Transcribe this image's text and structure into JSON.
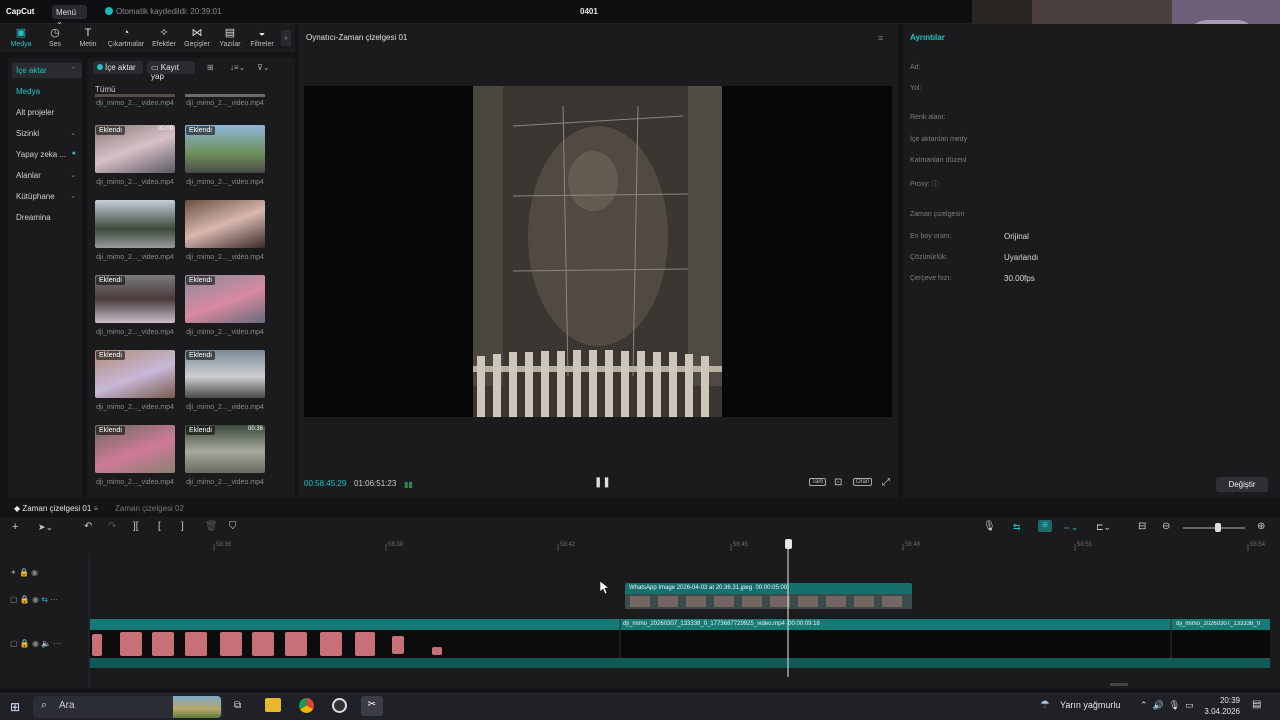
{
  "app": {
    "logo": "CapCut",
    "menu_label": "Menü",
    "autosave": "Otomatik kaydedildi: 20:39:01",
    "project_name": "0401"
  },
  "tool_tabs": [
    {
      "label": "Medya",
      "icon": "media-icon"
    },
    {
      "label": "Ses",
      "icon": "audio-icon"
    },
    {
      "label": "Metin",
      "icon": "text-icon"
    },
    {
      "label": "Çıkartmalar",
      "icon": "sticker-icon"
    },
    {
      "label": "Efektler",
      "icon": "effects-icon"
    },
    {
      "label": "Geçişler",
      "icon": "transitions-icon"
    },
    {
      "label": "Yazılar",
      "icon": "captions-icon"
    },
    {
      "label": "Filtreler",
      "icon": "filters-icon"
    }
  ],
  "left_nav": [
    {
      "label": "İçe aktar",
      "chev": "⌃"
    },
    {
      "label": "Medya",
      "chev": ""
    },
    {
      "label": "Alt projeler",
      "chev": ""
    },
    {
      "label": "Sizinki",
      "chev": "⌄"
    },
    {
      "label": "Yapay zeka ...",
      "chev": "⌄"
    },
    {
      "label": "Alanlar",
      "chev": "⌄"
    },
    {
      "label": "Kütüphane",
      "chev": "⌄"
    },
    {
      "label": "Dreamina",
      "chev": ""
    }
  ],
  "media_panel": {
    "import_label": "İçe aktar",
    "record_label": "Kayıt yap",
    "filter_all": "Tümü",
    "top_labels": [
      "dji_mimo_2..._video.mp4",
      "dji_mimo_2..._video.mp4"
    ],
    "added_tag": "Eklendi",
    "items": [
      {
        "label": "dji_mimo_2..._video.mp4",
        "tag": "Eklendi",
        "dur": "00:09"
      },
      {
        "label": "dji_mimo_2..._video.mp4",
        "tag": "Eklendi",
        "dur": ""
      },
      {
        "label": "dji_mimo_2..._video.mp4",
        "tag": "",
        "dur": ""
      },
      {
        "label": "dji_mimo_2..._video.mp4",
        "tag": "",
        "dur": ""
      },
      {
        "label": "dji_mimo_2..._video.mp4",
        "tag": "Eklendi",
        "dur": ""
      },
      {
        "label": "dji_mimo_2..._video.mp4",
        "tag": "Eklendi",
        "dur": ""
      },
      {
        "label": "dji_mimo_2..._video.mp4",
        "tag": "Eklendi",
        "dur": ""
      },
      {
        "label": "dji_mimo_2..._video.mp4",
        "tag": "Eklendi",
        "dur": ""
      },
      {
        "label": "dji_mimo_2..._video.mp4",
        "tag": "Eklendi",
        "dur": ""
      },
      {
        "label": "dji_mimo_2..._video.mp4",
        "tag": "Eklendi",
        "dur": "00:36"
      }
    ]
  },
  "player": {
    "title": "Oynatıcı-Zaman çizelgesi 01",
    "current_time": "00:58:45:29",
    "total_time": "01:06:51:23",
    "ratio_label": "Oran"
  },
  "details": {
    "title": "Ayrıntılar",
    "rows": [
      {
        "label": "Ad:",
        "value": ""
      },
      {
        "label": "Yol:",
        "value": ""
      },
      {
        "label": "Renk alanı:",
        "value": ""
      },
      {
        "label": "İçe aktarılan medy",
        "value": ""
      },
      {
        "label": "Katmanları düzenl",
        "value": ""
      },
      {
        "label": "Proxy:",
        "value": ""
      },
      {
        "label": "Zaman çizelgesin",
        "value": ""
      },
      {
        "label": "En boy oranı:",
        "value": "Orijinal"
      },
      {
        "label": "Çözünürlük:",
        "value": "Uyarlandı"
      },
      {
        "label": "Çerçeve hızı:",
        "value": "30.00fps"
      }
    ],
    "change_label": "Değiştir"
  },
  "timeline": {
    "tabs": [
      "Zaman çizelgesi 01",
      "Zaman çizelgesi 02"
    ],
    "ruler": [
      "58:36",
      "58:39",
      "58:42",
      "58:45",
      "58:48",
      "58:51",
      "58:54"
    ],
    "clips": {
      "image_clip": "WhatsApp Image 2026-04-03 at 20.36.31.jpeg",
      "image_clip_dur": "00:00:05:00",
      "video_clip_a": "dji_mimo_20260307_133338_0_1773687729925_video.mp4",
      "video_clip_a_dur": "00:00:09:18",
      "video_clip_b": "dji_mimo_20260307_133338_0"
    }
  },
  "taskbar": {
    "search_placeholder": "Ara",
    "weather": "Yarın yağmurlu",
    "time": "20:39",
    "date": "3.04.2026"
  },
  "colors": {
    "accent": "#23c2c2",
    "panel": "#1b1b1e",
    "background": "#141416",
    "clip": "#1e8a86"
  }
}
